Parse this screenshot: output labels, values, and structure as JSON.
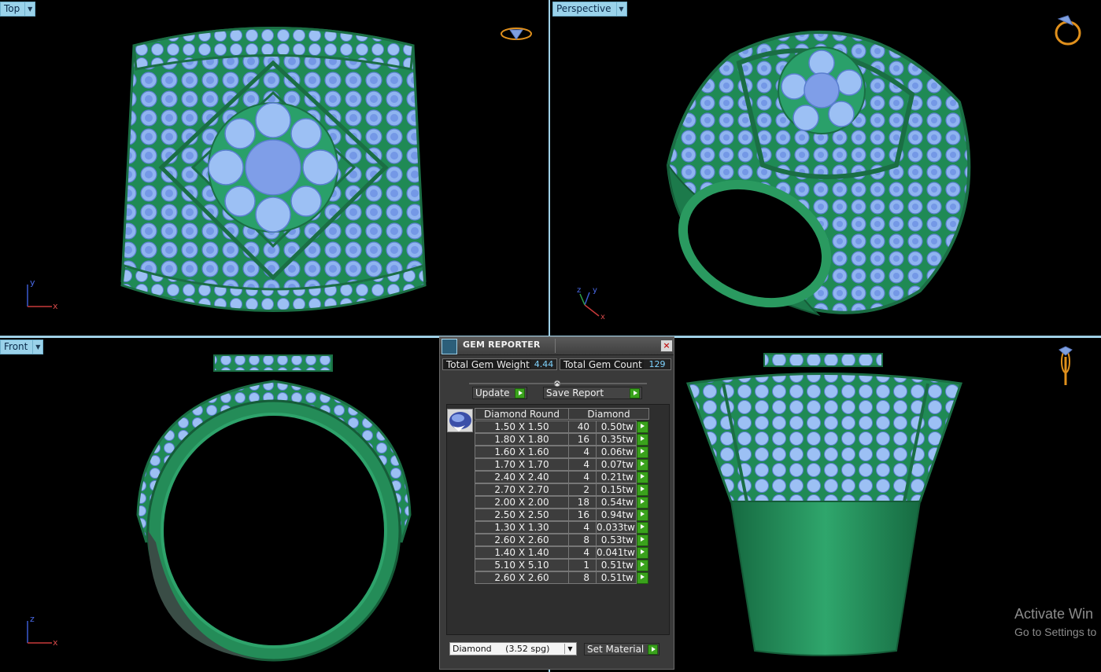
{
  "viewports": {
    "top_left": {
      "label": "Top"
    },
    "top_right": {
      "label": "Perspective"
    },
    "bottom_left": {
      "label": "Front"
    },
    "bottom_right": {
      "label": ""
    }
  },
  "axes": {
    "top": {
      "vertical": "y",
      "horizontal": "x"
    },
    "perspective": {
      "a": "z",
      "b": "y",
      "c": "x"
    },
    "front": {
      "vertical": "z",
      "horizontal": "x"
    }
  },
  "gem_reporter": {
    "title": "GEM REPORTER",
    "total_weight_label": "Total Gem Weight",
    "total_weight_value": "4.44",
    "total_count_label": "Total Gem Count",
    "total_count_value": "129",
    "update_label": "Update",
    "save_report_label": "Save Report",
    "col_shape": "Diamond Round",
    "col_material": "Diamond",
    "rows": [
      {
        "size": "1.50 X 1.50",
        "count": "40",
        "weight": "0.50tw"
      },
      {
        "size": "1.80 X 1.80",
        "count": "16",
        "weight": "0.35tw"
      },
      {
        "size": "1.60 X 1.60",
        "count": "4",
        "weight": "0.06tw"
      },
      {
        "size": "1.70 X 1.70",
        "count": "4",
        "weight": "0.07tw"
      },
      {
        "size": "2.40 X 2.40",
        "count": "4",
        "weight": "0.21tw"
      },
      {
        "size": "2.70 X 2.70",
        "count": "2",
        "weight": "0.15tw"
      },
      {
        "size": "2.00 X 2.00",
        "count": "18",
        "weight": "0.54tw"
      },
      {
        "size": "2.50 X 2.50",
        "count": "16",
        "weight": "0.94tw"
      },
      {
        "size": "1.30 X 1.30",
        "count": "4",
        "weight": "0.033tw"
      },
      {
        "size": "2.60 X 2.60",
        "count": "8",
        "weight": "0.53tw"
      },
      {
        "size": "1.40 X 1.40",
        "count": "4",
        "weight": "0.041tw"
      },
      {
        "size": "5.10 X 5.10",
        "count": "1",
        "weight": "0.51tw"
      },
      {
        "size": "2.60 X 2.60",
        "count": "8",
        "weight": "0.51tw"
      }
    ],
    "material_select": "Diamond     (3.52 spg)",
    "set_material_label": "Set Material"
  },
  "watermark": {
    "line1": "Activate Win",
    "line2": "Go to Settings to"
  },
  "colors": {
    "metal": "#1f8a55",
    "gem": "#8fb4f0",
    "viewport_label": "#9ad2ea",
    "accent_green": "#3aa21c"
  }
}
